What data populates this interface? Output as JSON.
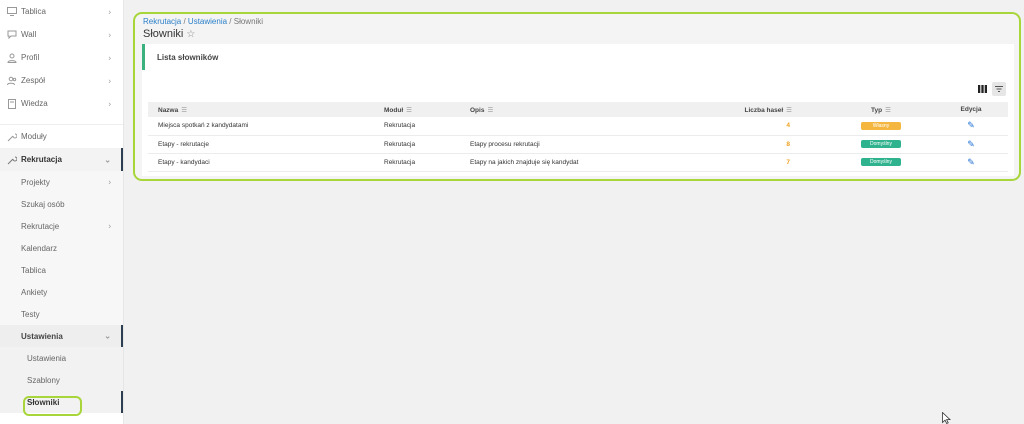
{
  "sidebar": {
    "items": [
      {
        "label": "Tablica",
        "icon": "monitor-icon",
        "chevron": "›"
      },
      {
        "label": "Wall",
        "icon": "chat-icon",
        "chevron": "›"
      },
      {
        "label": "Profil",
        "icon": "user-icon",
        "chevron": "›"
      },
      {
        "label": "Zespół",
        "icon": "team-icon",
        "chevron": "›"
      },
      {
        "label": "Wiedza",
        "icon": "book-icon",
        "chevron": "›"
      }
    ],
    "moduly": {
      "label": "Moduły",
      "icon": "wrench-icon"
    },
    "rekrutacja": {
      "label": "Rekrutacja",
      "icon": "wrench-icon",
      "chevron": "⌄",
      "children": [
        {
          "label": "Projekty",
          "chevron": "›"
        },
        {
          "label": "Szukaj osób",
          "chevron": ""
        },
        {
          "label": "Rekrutacje",
          "chevron": "›"
        },
        {
          "label": "Kalendarz",
          "chevron": ""
        },
        {
          "label": "Tablica",
          "chevron": ""
        },
        {
          "label": "Ankiety",
          "chevron": ""
        },
        {
          "label": "Testy",
          "chevron": ""
        }
      ],
      "ustawienia": {
        "label": "Ustawienia",
        "chevron": "⌄",
        "children": [
          {
            "label": "Ustawienia"
          },
          {
            "label": "Szablony"
          },
          {
            "label": "Słowniki"
          }
        ]
      }
    }
  },
  "breadcrumb": {
    "part1": "Rekrutacja",
    "sep1": " / ",
    "part2": "Ustawienia",
    "sep2": " / ",
    "part3": "Słowniki"
  },
  "page_title": "Słowniki",
  "card_title": "Lista słowników",
  "table": {
    "headers": {
      "nazwa": "Nazwa",
      "modul": "Moduł",
      "opis": "Opis",
      "liczba": "Liczba haseł",
      "typ": "Typ",
      "edycja": "Edycja"
    },
    "rows": [
      {
        "nazwa": "Miejsca spotkań z kandydatami",
        "modul": "Rekrutacja",
        "opis": "",
        "liczba": "4",
        "typ": "Własny",
        "typ_color": "#f4b63f"
      },
      {
        "nazwa": "Etapy - rekrutacje",
        "modul": "Rekrutacja",
        "opis": "Etapy procesu rekrutacji",
        "liczba": "8",
        "typ": "Domyślny",
        "typ_color": "#2fb38e"
      },
      {
        "nazwa": "Etapy - kandydaci",
        "modul": "Rekrutacja",
        "opis": "Etapy na jakich znajduje się kandydat",
        "liczba": "7",
        "typ": "Domyślny",
        "typ_color": "#2fb38e"
      }
    ]
  },
  "colors": {
    "highlight": "#a8d63a",
    "link": "#2a7fc9",
    "accent_green": "#3bb27e",
    "count": "#f0a020"
  }
}
